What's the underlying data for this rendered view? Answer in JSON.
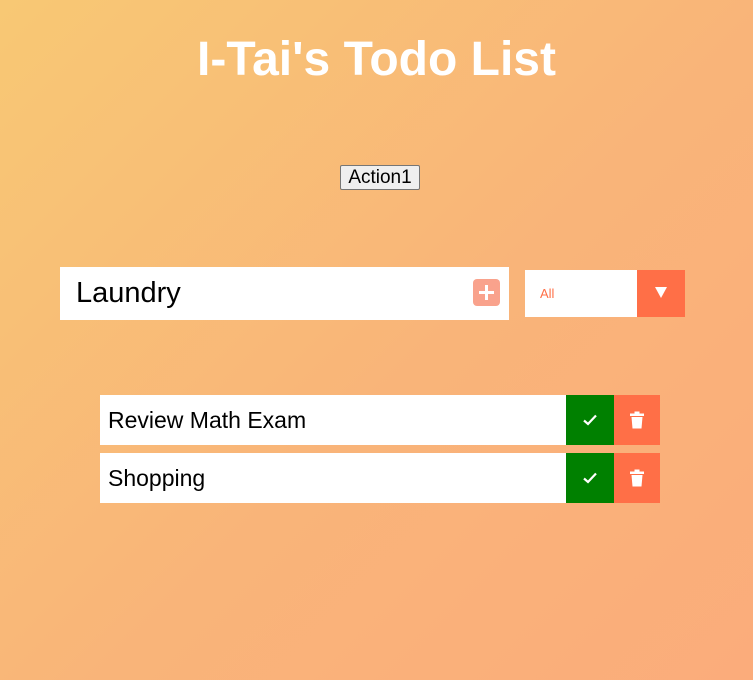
{
  "header": {
    "title": "I-Tai's Todo List"
  },
  "toolbar": {
    "action_label": "Action1"
  },
  "form": {
    "input_value": "Laundry",
    "add_icon": "plus-icon"
  },
  "filter": {
    "selected": "All",
    "arrow_icon": "caret-down-icon"
  },
  "todos": [
    {
      "text": "Review Math Exam"
    },
    {
      "text": "Shopping"
    }
  ],
  "colors": {
    "accent": "#ff6f47",
    "complete": "#008000",
    "add_button": "#f9a28c",
    "text_white": "#ffffff"
  }
}
